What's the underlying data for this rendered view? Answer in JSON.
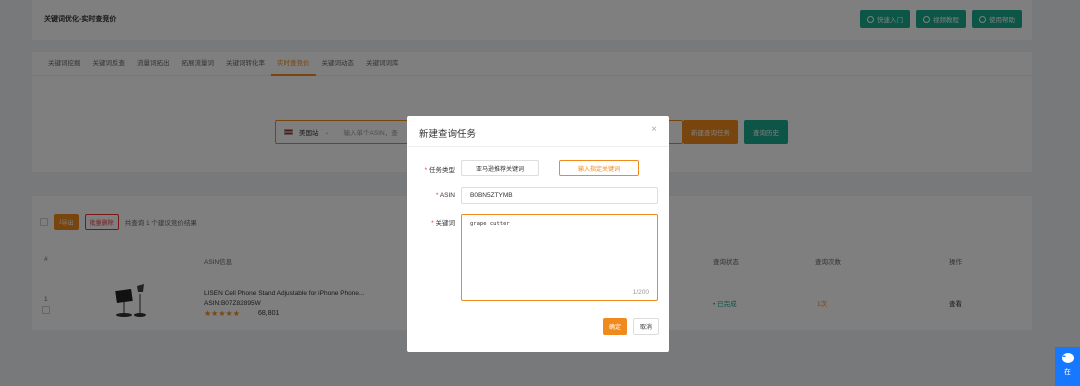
{
  "topbar": {
    "title": "关键词优化-实时查竞价",
    "buttons": [
      "快速入门",
      "视频教程",
      "使用帮助"
    ]
  },
  "tabs": [
    "关键词挖掘",
    "关键词反查",
    "流量词拓出",
    "拓展流量词",
    "关键词转化率",
    "实时查竞价",
    "关键词动态",
    "关键词词库"
  ],
  "search": {
    "country": "美国站",
    "placeholder": "输入单个ASIN，查",
    "new_task_label": "新建查询任务",
    "history_label": "查询历史"
  },
  "results": {
    "export_label": "导出",
    "delete_label": "批量删除",
    "count_text": "共查询 1 个建议竞价结果",
    "headers": {
      "index": "#",
      "asin_info": "ASIN信息",
      "status": "查询状态",
      "times": "查询次数",
      "action": "操作"
    },
    "row": {
      "index": "1",
      "title": "LISEN Cell Phone Stand Adjustable for iPhone Phone...",
      "asin": "ASIN:B07Z82895W",
      "stars": "★★★★★",
      "rating": 4.5,
      "reviews": "68,801",
      "status": "• 已完成",
      "times": "1次",
      "action": "查看"
    }
  },
  "modal": {
    "title": "新建查询任务",
    "close": "×",
    "task_type_label": "任务类型",
    "type_option_1": "亚马逊推荐关键词",
    "type_option_2": "输入指定关键词",
    "asin_label": "ASIN",
    "asin_value": "B0BN5ZTYMB",
    "keyword_label": "关键词",
    "keyword_value": "grape cutter",
    "keyword_count": "1/200",
    "ok_label": "确定",
    "cancel_label": "取消"
  },
  "chat": {
    "label": "在"
  },
  "colors": {
    "accent": "#f08a1c",
    "teal": "#1aaa8f",
    "chat": "#1677ff"
  }
}
